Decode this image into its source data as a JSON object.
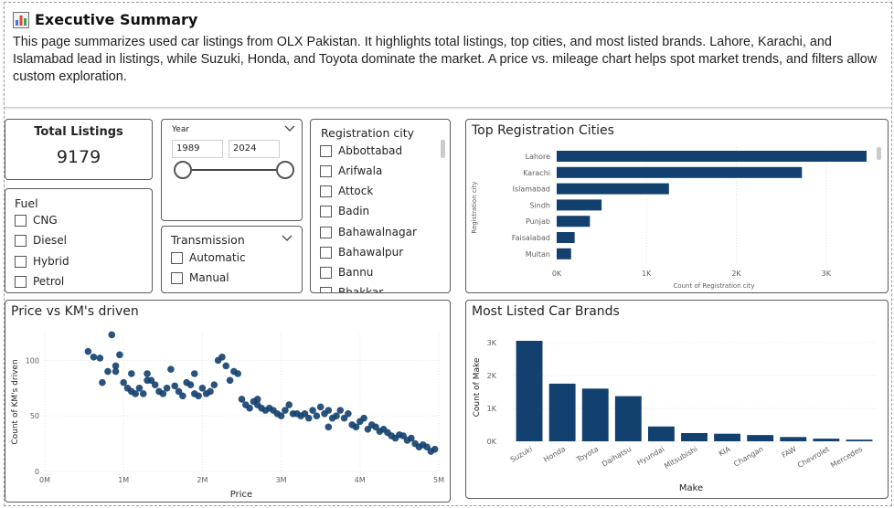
{
  "summary": {
    "icon": "bar-chart-icon",
    "title": "Executive Summary",
    "text": "This page summarizes used car listings from OLX Pakistan. It highlights total listings, top cities, and most listed brands. Lahore, Karachi, and Islamabad lead in listings, while Suzuki, Honda, and Toyota dominate the market. A price vs. mileage chart helps spot market trends, and filters allow custom exploration."
  },
  "kpi": {
    "label": "Total Listings",
    "value": "9179"
  },
  "fuel": {
    "title": "Fuel",
    "options": [
      "CNG",
      "Diesel",
      "Hybrid",
      "Petrol"
    ]
  },
  "year": {
    "title": "Year",
    "from": "1989",
    "to": "2024"
  },
  "transmission": {
    "title": "Transmission",
    "options": [
      "Automatic",
      "Manual"
    ]
  },
  "registration": {
    "title": "Registration city",
    "options": [
      "Abbottabad",
      "Arifwala",
      "Attock",
      "Badin",
      "Bahawalnagar",
      "Bahawalpur",
      "Bannu",
      "Bhakkar"
    ]
  },
  "colors": {
    "bar": "#12406f",
    "grid": "#e6e6e6",
    "axis_text": "#605e5c",
    "border": "#5b5b5b"
  },
  "chart_data": [
    {
      "id": "top_cities",
      "type": "bar",
      "orientation": "horizontal",
      "title": "Top Registration Cities",
      "xlabel": "Count of Registration city",
      "ylabel": "Registration city",
      "categories": [
        "Lahore",
        "Karachi",
        "Islamabad",
        "Sindh",
        "Punjab",
        "Faisalabad",
        "Multan"
      ],
      "values": [
        3450,
        2730,
        1250,
        500,
        370,
        200,
        160
      ],
      "xticks": [
        0,
        1000,
        2000,
        3000
      ],
      "xtick_labels": [
        "0K",
        "1K",
        "2K",
        "3K"
      ],
      "xlim": [
        0,
        3450
      ],
      "grid": true
    },
    {
      "id": "price_vs_km",
      "type": "scatter",
      "title": "Price vs KM's driven",
      "xlabel": "Price",
      "ylabel": "Count of KM's driven",
      "xticks": [
        0,
        1000000,
        2000000,
        3000000,
        4000000,
        5000000
      ],
      "xtick_labels": [
        "0M",
        "1M",
        "2M",
        "3M",
        "4M",
        "5M"
      ],
      "yticks": [
        0,
        50,
        100
      ],
      "ytick_labels": [
        "0",
        "50",
        "100"
      ],
      "xlim": [
        0,
        5000000
      ],
      "ylim": [
        0,
        125
      ],
      "grid": true,
      "points": [
        [
          550000,
          108
        ],
        [
          620000,
          103
        ],
        [
          700000,
          102
        ],
        [
          730000,
          80
        ],
        [
          800000,
          90
        ],
        [
          850000,
          123
        ],
        [
          900000,
          95
        ],
        [
          950000,
          105
        ],
        [
          1000000,
          80
        ],
        [
          1050000,
          75
        ],
        [
          1100000,
          72
        ],
        [
          1150000,
          70
        ],
        [
          1200000,
          75
        ],
        [
          1250000,
          70
        ],
        [
          1300000,
          88
        ],
        [
          1350000,
          82
        ],
        [
          1400000,
          78
        ],
        [
          1450000,
          72
        ],
        [
          1500000,
          70
        ],
        [
          1550000,
          75
        ],
        [
          1600000,
          92
        ],
        [
          1650000,
          77
        ],
        [
          1700000,
          72
        ],
        [
          1750000,
          68
        ],
        [
          1800000,
          80
        ],
        [
          1850000,
          78
        ],
        [
          1900000,
          70
        ],
        [
          1950000,
          68
        ],
        [
          2000000,
          75
        ],
        [
          2050000,
          70
        ],
        [
          2100000,
          72
        ],
        [
          2150000,
          78
        ],
        [
          2200000,
          100
        ],
        [
          2250000,
          103
        ],
        [
          2300000,
          95
        ],
        [
          2350000,
          82
        ],
        [
          2400000,
          90
        ],
        [
          2450000,
          88
        ],
        [
          2500000,
          65
        ],
        [
          2550000,
          60
        ],
        [
          2600000,
          57
        ],
        [
          2650000,
          63
        ],
        [
          2700000,
          60
        ],
        [
          2750000,
          57
        ],
        [
          2800000,
          55
        ],
        [
          2850000,
          57
        ],
        [
          2900000,
          55
        ],
        [
          2950000,
          52
        ],
        [
          3000000,
          50
        ],
        [
          3050000,
          55
        ],
        [
          3100000,
          60
        ],
        [
          3150000,
          52
        ],
        [
          3200000,
          52
        ],
        [
          3250000,
          50
        ],
        [
          3300000,
          52
        ],
        [
          3350000,
          48
        ],
        [
          3400000,
          55
        ],
        [
          3450000,
          50
        ],
        [
          3500000,
          58
        ],
        [
          3550000,
          52
        ],
        [
          3600000,
          55
        ],
        [
          3650000,
          48
        ],
        [
          3700000,
          50
        ],
        [
          3750000,
          55
        ],
        [
          3800000,
          48
        ],
        [
          3850000,
          52
        ],
        [
          3900000,
          42
        ],
        [
          3950000,
          40
        ],
        [
          4000000,
          45
        ],
        [
          4050000,
          48
        ],
        [
          4100000,
          38
        ],
        [
          4150000,
          42
        ],
        [
          4200000,
          40
        ],
        [
          4250000,
          36
        ],
        [
          4300000,
          38
        ],
        [
          4350000,
          35
        ],
        [
          4400000,
          32
        ],
        [
          4450000,
          30
        ],
        [
          4500000,
          33
        ],
        [
          4550000,
          32
        ],
        [
          4600000,
          28
        ],
        [
          4650000,
          30
        ],
        [
          4700000,
          25
        ],
        [
          4750000,
          22
        ],
        [
          4800000,
          24
        ],
        [
          4850000,
          22
        ],
        [
          4900000,
          18
        ],
        [
          4950000,
          20
        ],
        [
          1900000,
          88
        ],
        [
          900000,
          90
        ],
        [
          1100000,
          88
        ],
        [
          2700000,
          65
        ],
        [
          1300000,
          82
        ],
        [
          3600000,
          40
        ]
      ]
    },
    {
      "id": "brands",
      "type": "bar",
      "title": "Most Listed Car Brands",
      "xlabel": "Make",
      "ylabel": "Count of Make",
      "categories": [
        "Suzuki",
        "Honda",
        "Toyota",
        "Daihatsu",
        "Hyundai",
        "Mitsubishi",
        "KIA",
        "Changan",
        "FAW",
        "Chevrolet",
        "Mercedes"
      ],
      "values": [
        3050,
        1750,
        1600,
        1370,
        450,
        250,
        230,
        190,
        130,
        80,
        50
      ],
      "yticks": [
        0,
        1000,
        2000,
        3000
      ],
      "ytick_labels": [
        "0K",
        "1K",
        "2K",
        "3K"
      ],
      "ylim": [
        0,
        3300
      ],
      "grid": true
    }
  ]
}
